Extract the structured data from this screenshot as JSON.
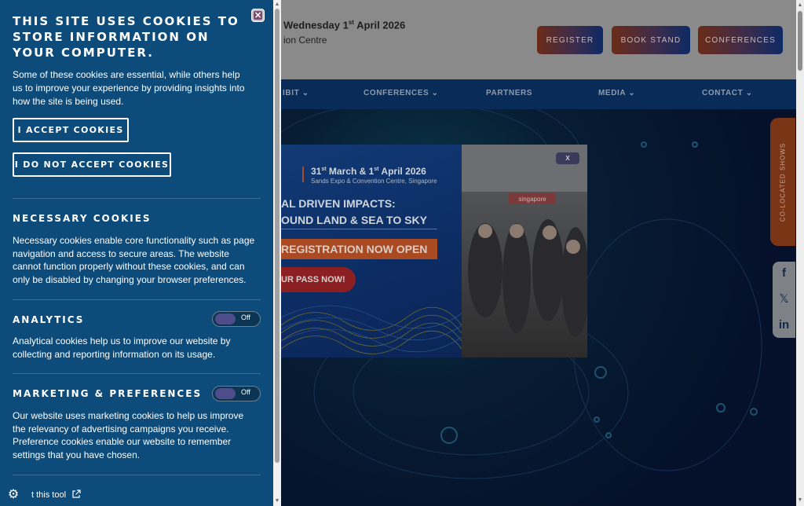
{
  "header": {
    "date_prefix": "Wednesday 1",
    "date_sup": "st",
    "date_suffix": " April 2026",
    "venue": "ion Centre",
    "buttons": [
      "REGISTER",
      "BOOK STAND",
      "CONFERENCES"
    ]
  },
  "nav": {
    "items": [
      "IBIT",
      "CONFERENCES",
      "PARTNERS",
      "MEDIA",
      "CONTACT"
    ]
  },
  "side_tab": {
    "label": "CO-LOCATED SHOWS"
  },
  "social": {
    "facebook": "f",
    "x": "𝕏",
    "linkedin": "in"
  },
  "popup": {
    "date_a": "31",
    "date_a_sup": "st",
    "date_mid": " March & 1",
    "date_b_sup": "st",
    "date_end": " April 2026",
    "venue": "Sands Expo & Convention Centre, Singapore",
    "headline_1": "AL DRIVEN IMPACTS:",
    "headline_2": "OUND LAND & SEA TO SKY",
    "registration": "REGISTRATION NOW OPEN",
    "pass_button": "UR PASS NOW!",
    "close": "X",
    "sign_text": "singapore"
  },
  "cookie_panel": {
    "title": "THIS SITE USES COOKIES TO STORE INFORMATION ON YOUR COMPUTER.",
    "intro": "Some of these cookies are essential, while others help us to improve your experience by providing insights into how the site is being used.",
    "accept_label": "I ACCEPT COOKIES",
    "reject_label": "I DO NOT ACCEPT COOKIES",
    "necessary": {
      "title": "NECESSARY COOKIES",
      "text": "Necessary cookies enable core functionality such as page navigation and access to secure areas. The website cannot function properly without these cookies, and can only be disabled by changing your browser preferences."
    },
    "analytics": {
      "title": "ANALYTICS",
      "toggle": "Off",
      "text": "Analytical cookies help us to improve our website by collecting and reporting information on its usage."
    },
    "marketing": {
      "title": "MARKETING & PREFERENCES",
      "toggle": "Off",
      "text": "Our website uses marketing cookies to help us improve the relevancy of advertising campaigns you receive. Preference cookies enable our website to remember settings that you have chosen."
    },
    "footer_link": "t this tool"
  },
  "colors": {
    "cookie_panel_bg": "#0d4b7a",
    "nav_bg": "#082b57",
    "popup_orange": "#a94a22"
  }
}
